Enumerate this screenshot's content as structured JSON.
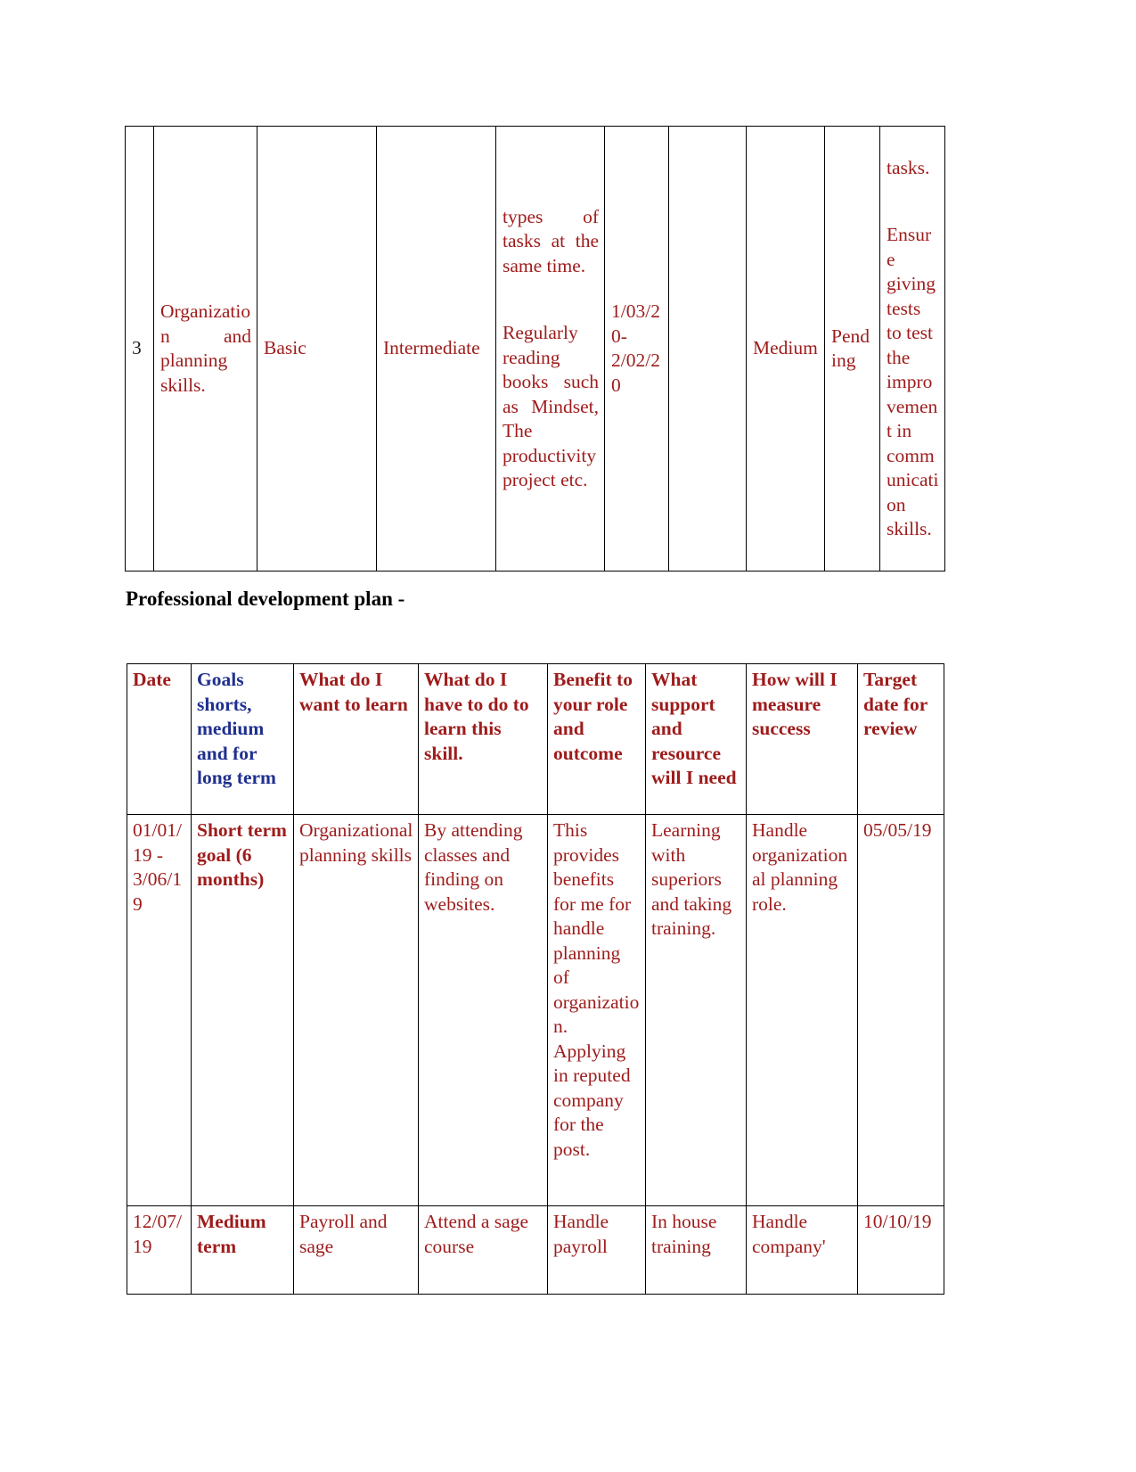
{
  "document": {
    "heading": "Professional development plan -",
    "text_color": "#9e1b1b",
    "heading_color": "#000000",
    "accent_blue": "#1f2f8f"
  },
  "table1": {
    "name": "skills-development-table-continued",
    "rows": [
      {
        "index": "3",
        "skill": "Organization and planning skills.",
        "current_level": "Basic",
        "target_level": "Intermediate",
        "activity_top": "types of tasks at the same time.",
        "activity_main": "Regularly reading books such as Mindset, The productivity project etc.",
        "dates": "1/03/20-2/02/20",
        "col7": "",
        "priority": "Medium",
        "status": "Pending",
        "evidence_top": "tasks.",
        "evidence_main": "Ensure giving tests to test the improvement in communication skills."
      }
    ]
  },
  "table2": {
    "name": "professional-development-plan-table",
    "headers": [
      "Date",
      "Goals shorts, medium and for long term",
      "What do I want to learn",
      "What do I have to do to learn this skill.",
      "Benefit to your role and outcome",
      "What support and resource will I need",
      "How will I measure success",
      "Target date for review"
    ],
    "rows": [
      {
        "date": "01/01/19 - 3/06/19",
        "goal": "Short term goal (6 months)",
        "want_to_learn": "Organizational planning skills",
        "how_to_learn": "By attending classes and finding on websites.",
        "benefit": "This provides benefits for me for handle planning of organization. Applying in reputed company for the post.",
        "support": "Learning with superiors and taking training.",
        "measure": "Handle organizational planning role.",
        "target_date": "05/05/19"
      },
      {
        "date": "12/07/19",
        "goal": "Medium term",
        "want_to_learn": "Payroll and sage",
        "how_to_learn": "Attend a sage course",
        "benefit": "Handle payroll",
        "support": "In house training",
        "measure": "Handle company'",
        "target_date": "10/10/19"
      }
    ]
  }
}
